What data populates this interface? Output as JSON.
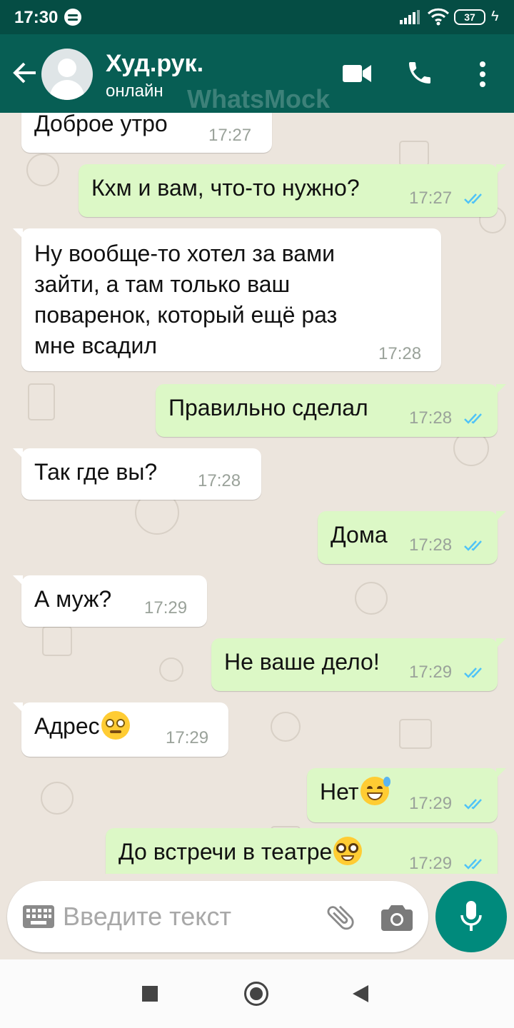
{
  "status_bar": {
    "time": "17:30",
    "battery": "37"
  },
  "header": {
    "contact_name": "Худ.рук.",
    "status": "онлайн",
    "watermark": "WhatsMock"
  },
  "messages": [
    {
      "dir": "in",
      "text": "Доброе утро",
      "time": "17:27"
    },
    {
      "dir": "out",
      "text": "Кхм и вам, что-то нужно?",
      "time": "17:27",
      "read": true
    },
    {
      "dir": "in",
      "lines": [
        "Ну вообще-то хотел за вами",
        "зайти, а там только ваш",
        "поваренок, который ещё раз",
        "мне всадил"
      ],
      "time": "17:28"
    },
    {
      "dir": "out",
      "text": "Правильно сделал",
      "time": "17:28",
      "read": true
    },
    {
      "dir": "in",
      "text": "Так где вы?",
      "time": "17:28"
    },
    {
      "dir": "out",
      "text": "Дома",
      "time": "17:28",
      "read": true
    },
    {
      "dir": "in",
      "text": "А муж?",
      "time": "17:29"
    },
    {
      "dir": "out",
      "text": "Не ваше дело!",
      "time": "17:29",
      "read": true
    },
    {
      "dir": "in",
      "text": "Адрес",
      "emoji": "face-with-rolling-eyes",
      "time": "17:29"
    },
    {
      "dir": "out",
      "text": "Нет",
      "emoji": "grinning-face-with-sweat",
      "time": "17:29",
      "read": true
    },
    {
      "dir": "out",
      "text": "До встречи в театре",
      "emoji": "nerd-face",
      "time": "17:29",
      "read": true
    }
  ],
  "composer": {
    "placeholder": "Введите текст"
  },
  "colors": {
    "header": "#075e54",
    "status_bar": "#054d44",
    "incoming": "#ffffff",
    "outgoing": "#dcf8c6",
    "read_ticks": "#4fc3f7",
    "mic_button": "#008a7c"
  }
}
